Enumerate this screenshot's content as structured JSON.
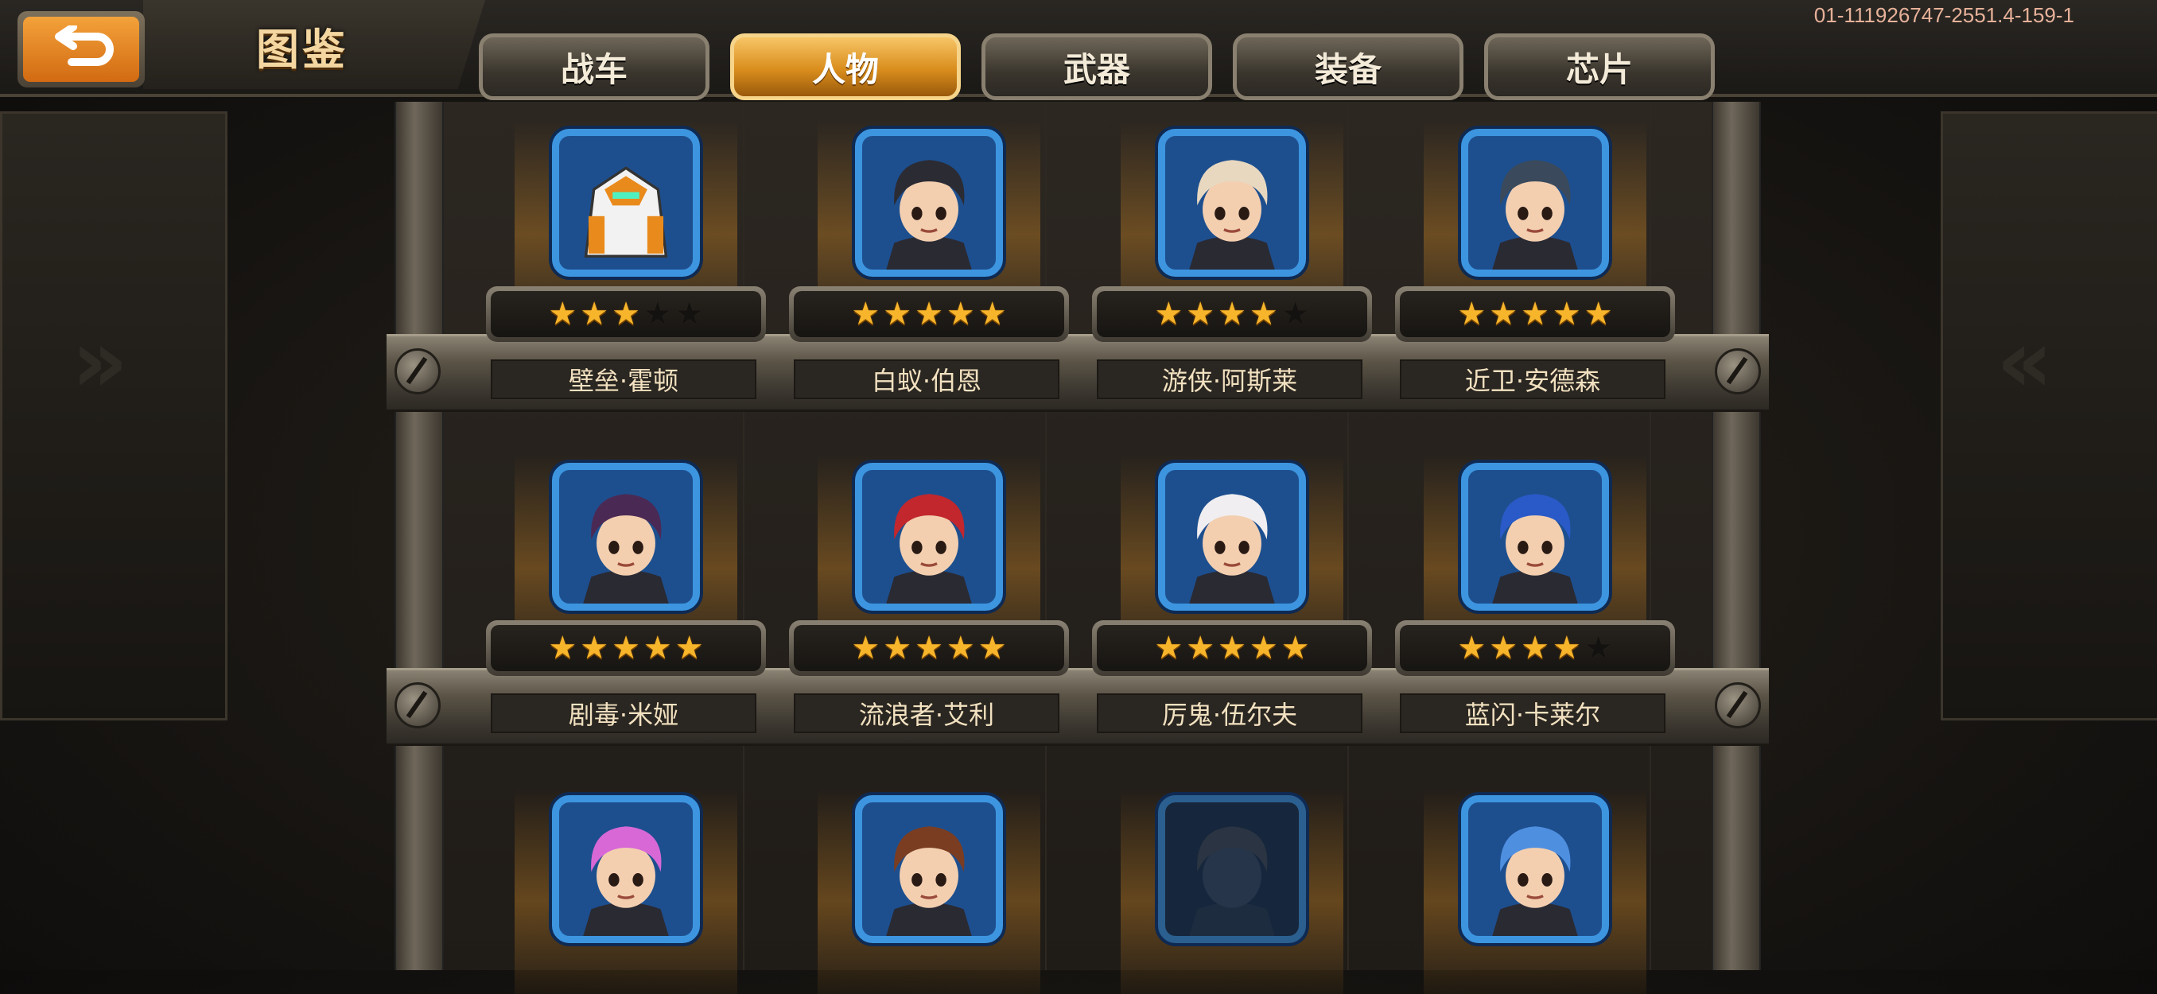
{
  "header": {
    "title": "图鉴",
    "build_id": "01-111926747-2551.4-159-1"
  },
  "tabs": [
    {
      "label": "战车",
      "active": false
    },
    {
      "label": "人物",
      "active": true
    },
    {
      "label": "武器",
      "active": false
    },
    {
      "label": "装备",
      "active": false
    },
    {
      "label": "芯片",
      "active": false
    }
  ],
  "characters": [
    {
      "name": "壁垒·霍顿",
      "stars": 3,
      "max_stars": 5,
      "portrait": "robot-mech-portrait",
      "hair": "#f2f2f2"
    },
    {
      "name": "白蚁·伯恩",
      "stars": 5,
      "max_stars": 5,
      "portrait": "dark-hair-man-portrait",
      "hair": "#2b2b33"
    },
    {
      "name": "游侠·阿斯莱",
      "stars": 4,
      "max_stars": 5,
      "portrait": "cowboy-hat-portrait",
      "hair": "#e8d8c0"
    },
    {
      "name": "近卫·安德森",
      "stars": 5,
      "max_stars": 5,
      "portrait": "soldier-cap-portrait",
      "hair": "#3a4a5c"
    },
    {
      "name": "剧毒·米娅",
      "stars": 5,
      "max_stars": 5,
      "portrait": "purple-hair-girl-portrait",
      "hair": "#4a2a55"
    },
    {
      "name": "流浪者·艾利",
      "stars": 5,
      "max_stars": 5,
      "portrait": "red-hair-goggles-portrait",
      "hair": "#c1272d"
    },
    {
      "name": "厉鬼·伍尔夫",
      "stars": 5,
      "max_stars": 5,
      "portrait": "white-hair-man-portrait",
      "hair": "#f0eef0"
    },
    {
      "name": "蓝闪·卡莱尔",
      "stars": 4,
      "max_stars": 5,
      "portrait": "blue-hair-man-portrait",
      "hair": "#2a5ac8"
    },
    {
      "name": "",
      "stars": 0,
      "max_stars": 5,
      "portrait": "pink-hair-portrait",
      "hair": "#d768d6"
    },
    {
      "name": "",
      "stars": 0,
      "max_stars": 5,
      "portrait": "brown-hair-portrait",
      "hair": "#7a3d22"
    },
    {
      "name": "",
      "stars": 0,
      "max_stars": 5,
      "portrait": "locked-silhouette-portrait",
      "hair": "#2a3442"
    },
    {
      "name": "",
      "stars": 0,
      "max_stars": 5,
      "portrait": "blue-hair-girl-portrait",
      "hair": "#4f8fe0"
    }
  ],
  "icons": {
    "back": "back-arrow-icon",
    "star_on": "★",
    "star_off": "★"
  },
  "colors": {
    "accent_orange": "#e8891c",
    "portrait_border": "#3d95e0",
    "star_gold": "#f7b52b"
  }
}
